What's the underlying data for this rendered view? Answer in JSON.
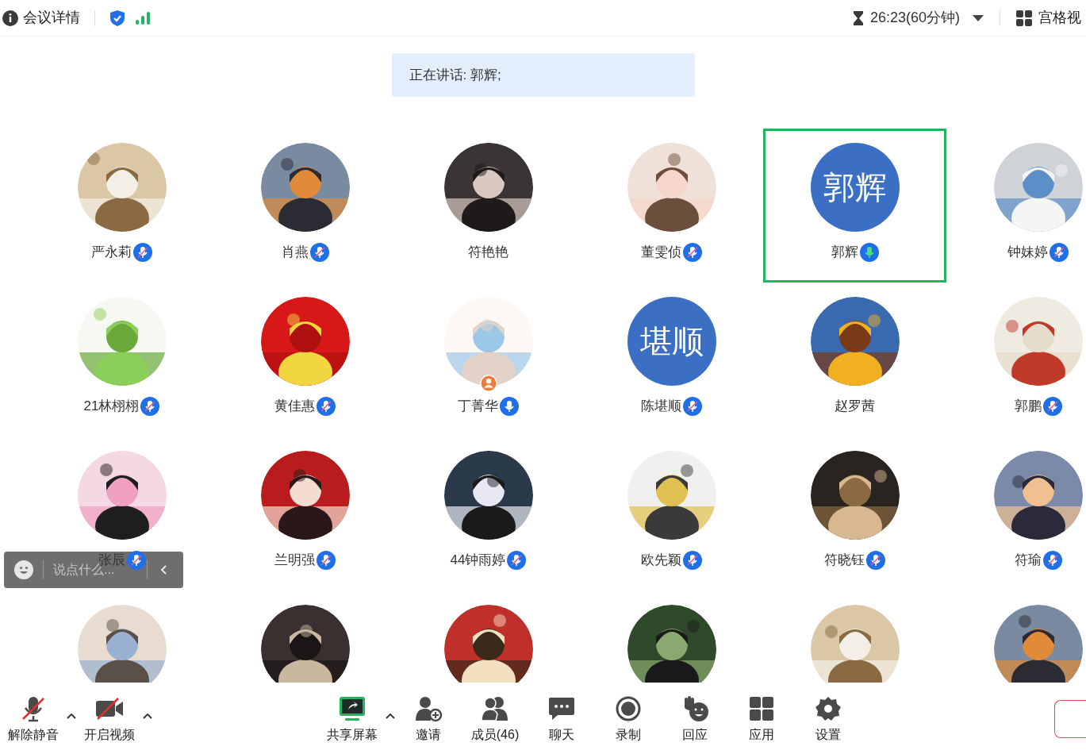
{
  "top_bar": {
    "details": "会议详情",
    "timer": "26:23(60分钟)",
    "view": "宫格视"
  },
  "speaking_banner": "正在讲话: 郭辉;",
  "participants": [
    {
      "name": "严永莉",
      "mic_muted": true,
      "speaking": false,
      "selected": false
    },
    {
      "name": "肖燕",
      "mic_muted": true,
      "speaking": false,
      "selected": false
    },
    {
      "name": "符艳艳",
      "selected": false
    },
    {
      "name": "董雯侦",
      "mic_muted": true,
      "speaking": false,
      "selected": false
    },
    {
      "name": "郭辉",
      "mic_muted": false,
      "speaking": true,
      "selected": true,
      "avatar": {
        "kind": "text",
        "text": "郭辉"
      }
    },
    {
      "name": "钟妹婷",
      "mic_muted": true,
      "speaking": false,
      "selected": false
    },
    {
      "name": "21林栩栩",
      "mic_muted": true,
      "speaking": false,
      "selected": false
    },
    {
      "name": "黄佳惠",
      "mic_muted": true,
      "speaking": false,
      "selected": false
    },
    {
      "name": "丁菁华",
      "mic_muted": false,
      "speaking": false,
      "host": true,
      "selected": false
    },
    {
      "name": "陈堪顺",
      "mic_muted": true,
      "speaking": false,
      "selected": false,
      "avatar": {
        "kind": "text",
        "text": "堪顺"
      }
    },
    {
      "name": "赵罗茜",
      "selected": false
    },
    {
      "name": "郭鹏",
      "mic_muted": true,
      "speaking": false,
      "selected": false
    },
    {
      "name": "张辰",
      "mic_muted": true,
      "speaking": false,
      "selected": false
    },
    {
      "name": "兰明强",
      "mic_muted": true,
      "speaking": false,
      "selected": false
    },
    {
      "name": "44钟雨婷",
      "mic_muted": true,
      "speaking": false,
      "selected": false
    },
    {
      "name": "欧先颖",
      "mic_muted": true,
      "speaking": false,
      "selected": false
    },
    {
      "name": "符晓钰",
      "mic_muted": true,
      "speaking": false,
      "selected": false
    },
    {
      "name": "符瑜",
      "mic_muted": true,
      "speaking": false,
      "selected": false
    },
    {
      "selected": false
    },
    {
      "selected": false
    },
    {
      "selected": false
    },
    {
      "selected": false
    },
    {
      "selected": false
    },
    {
      "selected": false
    }
  ],
  "chat_box": {
    "placeholder": "说点什么..."
  },
  "toolbar": [
    {
      "kind": "mic",
      "label": "解除静音",
      "menu": true
    },
    {
      "kind": "video",
      "label": "开启视频",
      "menu": true
    },
    {
      "kind": "share",
      "label": "共享屏幕",
      "menu": true
    },
    {
      "kind": "invite",
      "label": "邀请",
      "menu": false
    },
    {
      "kind": "members",
      "label": "成员(46)",
      "menu": false
    },
    {
      "kind": "chat",
      "label": "聊天",
      "menu": false
    },
    {
      "kind": "record",
      "label": "录制",
      "menu": false
    },
    {
      "kind": "react",
      "label": "回应",
      "menu": false
    },
    {
      "kind": "apps",
      "label": "应用",
      "menu": false
    },
    {
      "kind": "settings",
      "label": "设置",
      "menu": false
    }
  ]
}
